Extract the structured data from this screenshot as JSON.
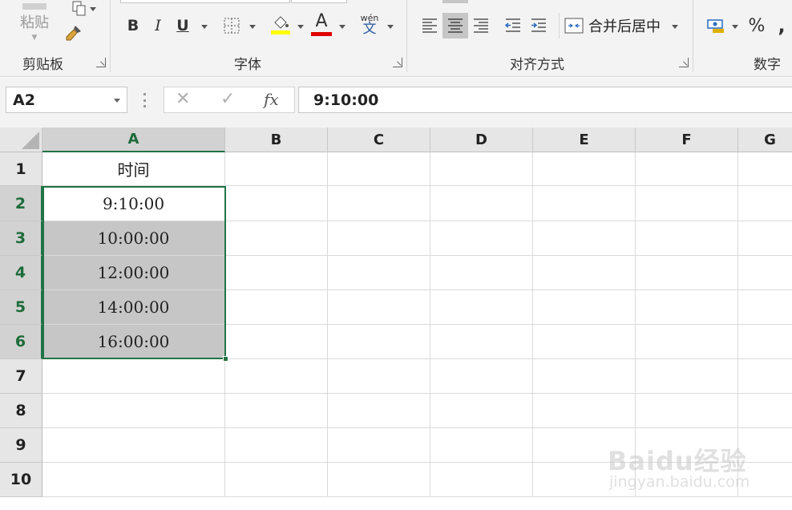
{
  "ribbon": {
    "clipboard": {
      "paste_label": "粘贴",
      "group_label": "剪贴板"
    },
    "font": {
      "group_label": "字体",
      "bold": "B",
      "italic": "I",
      "underline": "U",
      "font_color_glyph": "A",
      "phonetic_top": "wén",
      "phonetic_bottom": "文"
    },
    "alignment": {
      "group_label": "对齐方式",
      "merge_label": "合并后居中"
    },
    "number": {
      "group_label": "数字",
      "percent": "%",
      "comma": ","
    },
    "colors": {
      "fill_highlight": "#ffff00",
      "font_color": "#e00000",
      "accent": "#217346"
    }
  },
  "formula_bar": {
    "name_box": "A2",
    "cancel_glyph": "✕",
    "enter_glyph": "✓",
    "fx_glyph": "fx",
    "value": "9:10:00"
  },
  "sheet": {
    "columns": [
      "A",
      "B",
      "C",
      "D",
      "E",
      "F",
      "G"
    ],
    "rows": [
      "1",
      "2",
      "3",
      "4",
      "5",
      "6",
      "7",
      "8",
      "9",
      "10"
    ],
    "cells": {
      "A1": "时间",
      "A2": "9:10:00",
      "A3": "10:00:00",
      "A4": "12:00:00",
      "A5": "14:00:00",
      "A6": "16:00:00"
    },
    "active_cell": "A2",
    "selection": "A2:A6"
  },
  "watermark": {
    "brand": "Baidu经验",
    "url": "jingyan.baidu.com"
  }
}
